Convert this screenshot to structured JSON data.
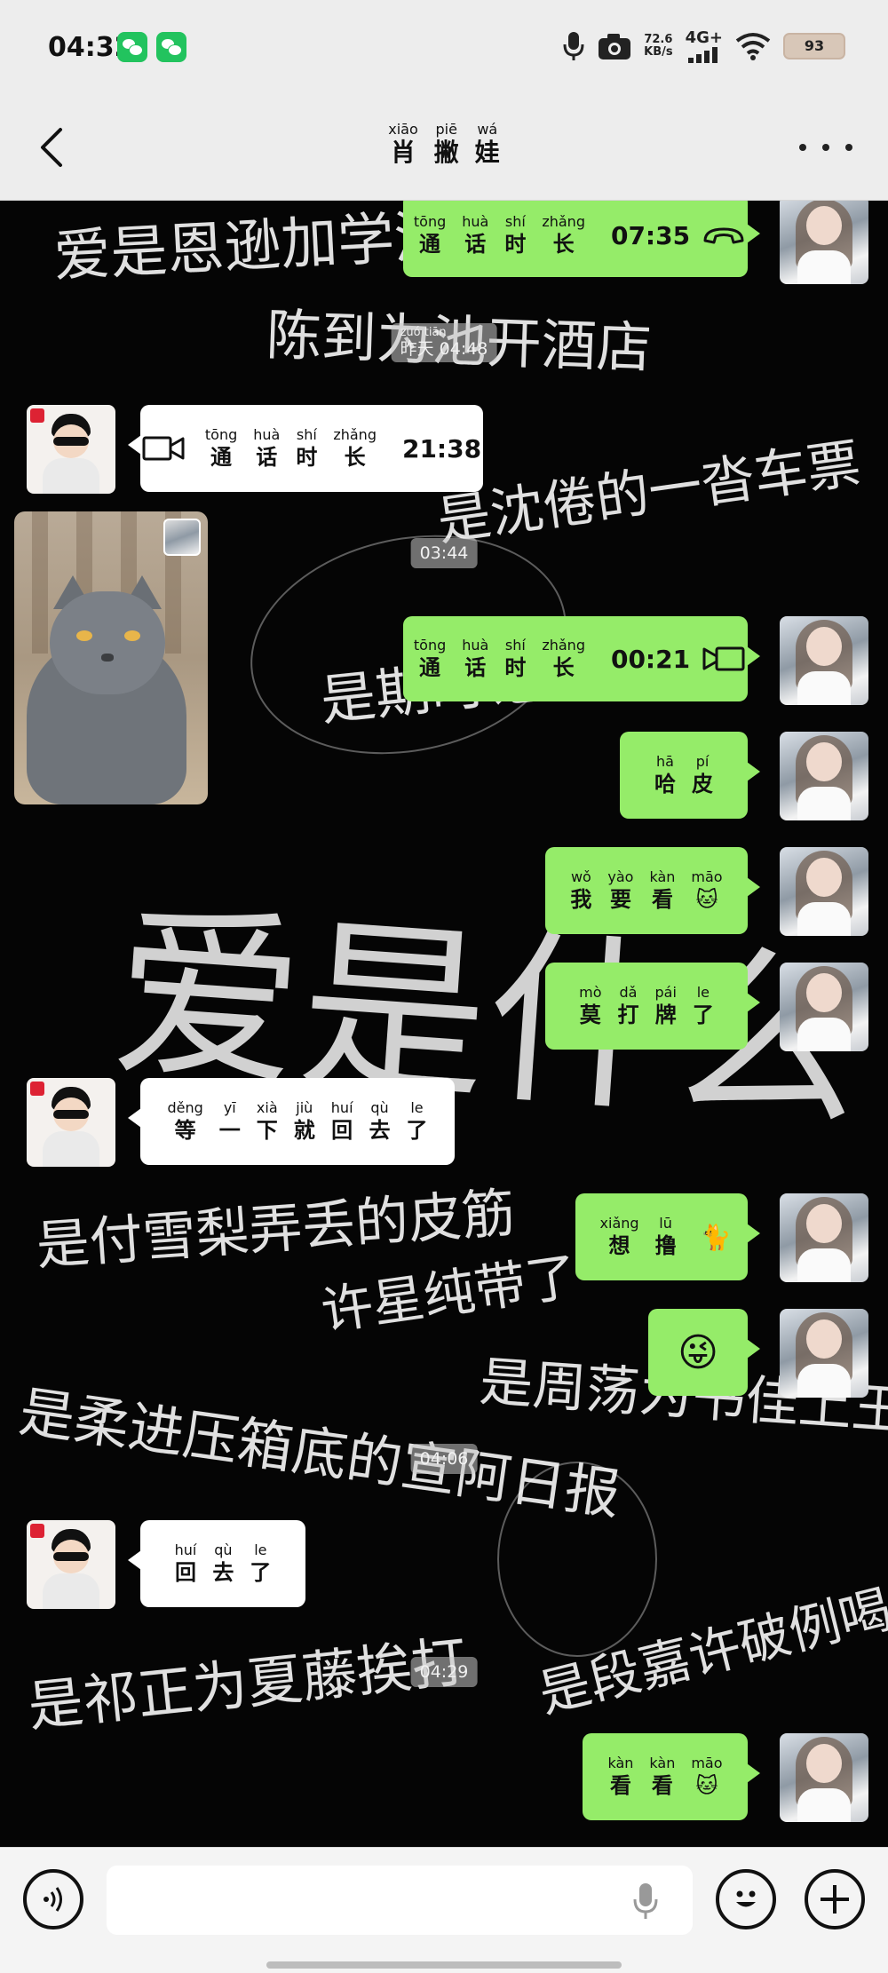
{
  "status_bar": {
    "time": "04:32",
    "net_speed_value": "72.6",
    "net_speed_unit": "KB/s",
    "network_type": "4G+",
    "battery": "93"
  },
  "nav": {
    "title_chars": [
      {
        "py": "xiāo",
        "hz": "肖"
      },
      {
        "py": "piē",
        "hz": "撇"
      },
      {
        "py": "wá",
        "hz": "娃"
      }
    ]
  },
  "messages": {
    "call1": {
      "words": [
        {
          "py": "tōng",
          "hz": "通"
        },
        {
          "py": "huà",
          "hz": "话"
        },
        {
          "py": "shí",
          "hz": "时"
        },
        {
          "py": "zhǎng",
          "hz": "长"
        }
      ],
      "duration": "07:35"
    },
    "ts1": {
      "py": "zuó tiān",
      "text": "昨天 04:48"
    },
    "call2": {
      "words": [
        {
          "py": "tōng",
          "hz": "通"
        },
        {
          "py": "huà",
          "hz": "话"
        },
        {
          "py": "shí",
          "hz": "时"
        },
        {
          "py": "zhǎng",
          "hz": "长"
        }
      ],
      "duration": "21:38"
    },
    "ts2": "03:44",
    "call3": {
      "words": [
        {
          "py": "tōng",
          "hz": "通"
        },
        {
          "py": "huà",
          "hz": "话"
        },
        {
          "py": "shí",
          "hz": "时"
        },
        {
          "py": "zhǎng",
          "hz": "长"
        }
      ],
      "duration": "00:21"
    },
    "m_hapi": [
      {
        "py": "hā",
        "hz": "哈"
      },
      {
        "py": "pí",
        "hz": "皮"
      }
    ],
    "m_woyaokan": {
      "words": [
        {
          "py": "wǒ",
          "hz": "我"
        },
        {
          "py": "yào",
          "hz": "要"
        },
        {
          "py": "kàn",
          "hz": "看"
        },
        {
          "py": "māo",
          "hz": "🐱"
        }
      ]
    },
    "m_modapaile": [
      {
        "py": "mò",
        "hz": "莫"
      },
      {
        "py": "dǎ",
        "hz": "打"
      },
      {
        "py": "pái",
        "hz": "牌"
      },
      {
        "py": "le",
        "hz": "了"
      }
    ],
    "m_deng": [
      {
        "py": "děng",
        "hz": "等"
      },
      {
        "py": "yī",
        "hz": "一"
      },
      {
        "py": "xià",
        "hz": "下"
      },
      {
        "py": "jiù",
        "hz": "就"
      },
      {
        "py": "huí",
        "hz": "回"
      },
      {
        "py": "qù",
        "hz": "去"
      },
      {
        "py": "le",
        "hz": "了"
      }
    ],
    "m_xianglu": {
      "words": [
        {
          "py": "xiǎng",
          "hz": "想"
        },
        {
          "py": "lū",
          "hz": "撸"
        }
      ],
      "emoji": "🐈"
    },
    "m_emoji": "😜",
    "ts3": "04:06",
    "m_huiqule": [
      {
        "py": "huí",
        "hz": "回"
      },
      {
        "py": "qù",
        "hz": "去"
      },
      {
        "py": "le",
        "hz": "了"
      }
    ],
    "ts4": "04:29",
    "m_kankan": {
      "words": [
        {
          "py": "kàn",
          "hz": "看"
        },
        {
          "py": "kàn",
          "hz": "看"
        },
        {
          "py": "māo",
          "hz": "🐱"
        }
      ]
    }
  },
  "background_lines": [
    "爱是恩逊加学酒",
    "陈到为池开酒店",
    "是沈倦的一沓车票",
    "是期时记",
    "爱是什么",
    "是付雪梨弄丢的皮筋",
    "许星纯带了一",
    "是周荡为书佳上王者",
    "是柔进压箱底的宣阿日报",
    "是祁正为夏藤挨打",
    "是段嘉许破例喝酒"
  ],
  "input": {
    "placeholder": ""
  },
  "colors": {
    "my_bubble": "#95ec69",
    "their_bubble": "#ffffff",
    "chat_bg": "#050505",
    "bar_bg": "#ededed"
  }
}
